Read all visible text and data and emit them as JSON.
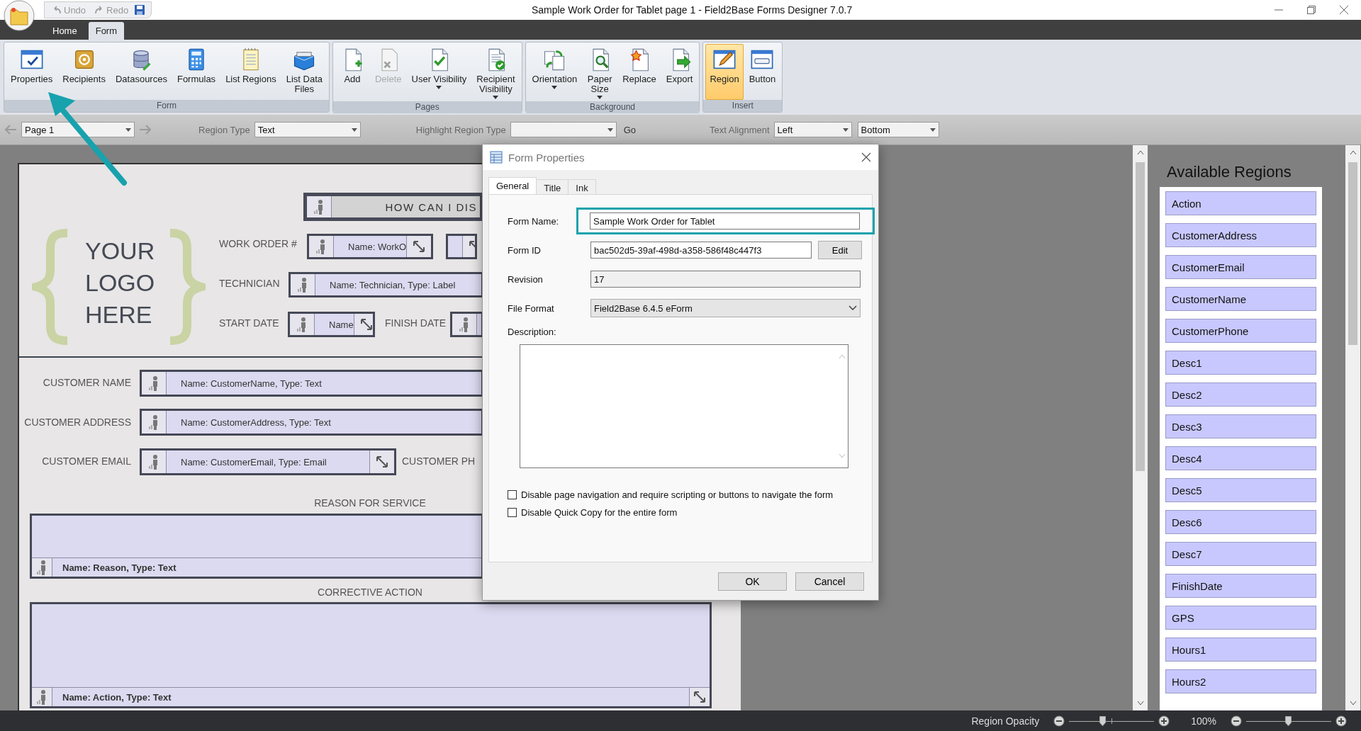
{
  "window": {
    "title": "Sample Work Order for Tablet page 1 - Field2Base Forms Designer 7.0.7"
  },
  "quick_access": [
    {
      "label": "Undo",
      "disabled": true
    },
    {
      "label": "Redo",
      "disabled": true
    }
  ],
  "ribbon_tabs": [
    {
      "label": "Home",
      "selected": false
    },
    {
      "label": "Form",
      "selected": true
    }
  ],
  "ribbon_groups": [
    {
      "label": "Form",
      "buttons": [
        {
          "label": "Properties",
          "disabled": false,
          "selected": false,
          "dropdown": false
        },
        {
          "label": "Recipients",
          "disabled": false,
          "selected": false,
          "dropdown": false
        },
        {
          "label": "Datasources",
          "disabled": false,
          "selected": false,
          "dropdown": false
        },
        {
          "label": "Formulas",
          "disabled": false,
          "selected": false,
          "dropdown": false
        },
        {
          "label": "List Regions",
          "disabled": false,
          "selected": false,
          "dropdown": false
        },
        {
          "label": "List Data\nFiles",
          "disabled": false,
          "selected": false,
          "dropdown": false
        }
      ]
    },
    {
      "label": "Pages",
      "buttons": [
        {
          "label": "Add",
          "disabled": false,
          "selected": false,
          "dropdown": false
        },
        {
          "label": "Delete",
          "disabled": true,
          "selected": false,
          "dropdown": false
        },
        {
          "label": "User Visibility",
          "disabled": false,
          "selected": false,
          "dropdown": true
        },
        {
          "label": "Recipient\nVisibility",
          "disabled": false,
          "selected": false,
          "dropdown": true
        }
      ]
    },
    {
      "label": "Background",
      "buttons": [
        {
          "label": "Orientation",
          "disabled": false,
          "selected": false,
          "dropdown": true
        },
        {
          "label": "Paper\nSize",
          "disabled": false,
          "selected": false,
          "dropdown": true
        },
        {
          "label": "Replace",
          "disabled": false,
          "selected": false,
          "dropdown": false
        },
        {
          "label": "Export",
          "disabled": false,
          "selected": false,
          "dropdown": false
        }
      ]
    },
    {
      "label": "Insert",
      "buttons": [
        {
          "label": "Region",
          "disabled": false,
          "selected": true,
          "dropdown": false
        },
        {
          "label": "Button",
          "disabled": false,
          "selected": false,
          "dropdown": false
        }
      ]
    }
  ],
  "toolbar": {
    "page": "Page 1",
    "region_type_label": "Region Type",
    "region_type": "Text",
    "highlight_label": "Highlight Region Type",
    "go_label": "Go",
    "alignment_label": "Text Alignment",
    "horizontal_alignment": "Left",
    "vertical_alignment": "Bottom"
  },
  "form_page": {
    "logo_lines": [
      "YOUR",
      "LOGO",
      "HERE"
    ],
    "labels": [
      "WORK ORDER #",
      "TECHNICIAN",
      "START DATE",
      "FINISH DATE",
      "CUSTOMER NAME",
      "CUSTOMER ADDRESS",
      "CUSTOMER EMAIL",
      "CUSTOMER PH",
      "REASON FOR SERVICE",
      "CORRECTIVE ACTION"
    ],
    "regions": [
      {
        "kind": "header",
        "text": "HOW CAN I DIS",
        "resize_handle": false
      },
      {
        "kind": "field",
        "text": "Name: WorkO",
        "resize_handle": true
      },
      {
        "kind": "button",
        "resize_handle": true
      },
      {
        "kind": "field",
        "text": "Name: Technician, Type: Label",
        "resize_handle": false
      },
      {
        "kind": "field",
        "text": "Name",
        "resize_handle": true
      },
      {
        "kind": "field"
      },
      {
        "kind": "field",
        "text": "Name: CustomerName, Type: Text",
        "resize_handle": false
      },
      {
        "kind": "field",
        "text": "Name: CustomerAddress, Type: Text",
        "resize_handle": false
      },
      {
        "kind": "field",
        "text": "Name: CustomerEmail, Type: Email",
        "resize_handle": true
      },
      {
        "kind": "multiline",
        "text": "Name: Reason, Type: Text",
        "resize_handle": false
      },
      {
        "kind": "multiline",
        "text": "Name: Action, Type: Text",
        "resize_handle": true
      }
    ]
  },
  "dialog": {
    "title": "Form Properties",
    "tabs": [
      {
        "label": "General",
        "selected": true
      },
      {
        "label": "Title",
        "selected": false
      },
      {
        "label": "Ink",
        "selected": false
      }
    ],
    "form_name": {
      "label": "Form Name:",
      "value": "Sample Work Order for Tablet",
      "read_only": false
    },
    "form_id": {
      "label": "Form ID",
      "value": "bac502d5-39af-498d-a358-586f48c447f3",
      "read_only": false,
      "button": "Edit"
    },
    "revision": {
      "label": "Revision",
      "value": "17",
      "read_only": true
    },
    "file_format": {
      "label": "File Format",
      "value": "Field2Base 6.4.5 eForm"
    },
    "description": {
      "label": "Description:"
    },
    "checkboxes": [
      {
        "label": "Disable page navigation and require scripting or buttons to navigate the form",
        "checked": false
      },
      {
        "label": "Disable Quick Copy for the entire form",
        "checked": false
      }
    ],
    "buttons": [
      "OK",
      "Cancel"
    ]
  },
  "available_regions": {
    "title": "Available Regions",
    "items": [
      "Action",
      "CustomerAddress",
      "CustomerEmail",
      "CustomerName",
      "CustomerPhone",
      "Desc1",
      "Desc2",
      "Desc3",
      "Desc4",
      "Desc5",
      "Desc6",
      "Desc7",
      "FinishDate",
      "GPS",
      "Hours1",
      "Hours2"
    ]
  },
  "status_bar": {
    "opacity_label": "Region Opacity",
    "opacity": {
      "level": 0.39
    },
    "zoom_reading": "100%",
    "zoom": {
      "level": 0.49
    }
  }
}
